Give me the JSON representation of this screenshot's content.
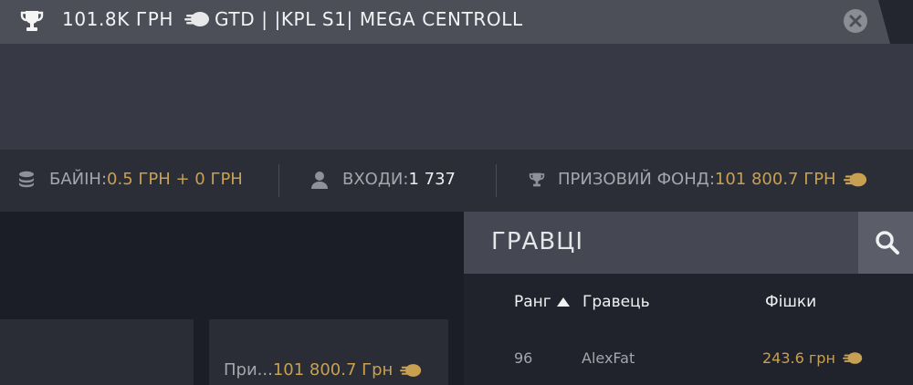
{
  "tab": {
    "prize": "101.8K ГРН",
    "title": "GTD | |KPL S1| MEGA CENTROLL"
  },
  "info": {
    "buyin_label": "БАЙІН:",
    "buyin_value": "0.5 ГРН + 0 ГРН",
    "entries_label": "ВХОДИ: ",
    "entries_value": "1 737",
    "prize_label": "ПРИЗОВИЙ ФОНД: ",
    "prize_value": "101 800.7 ГРН"
  },
  "card": {
    "prefix": "При...",
    "value": "101 800.7 Грн"
  },
  "players": {
    "title": "ГРАВЦІ",
    "columns": {
      "rank": "Ранг",
      "player": "Гравець",
      "chips": "Фішки"
    },
    "rows": [
      {
        "rank": "96",
        "player": "AlexFat",
        "chips": "243.6 грн"
      }
    ]
  },
  "colors": {
    "accent_gold": "#c8a052",
    "panel_dark": "#1c1f28",
    "header": "#454852"
  }
}
